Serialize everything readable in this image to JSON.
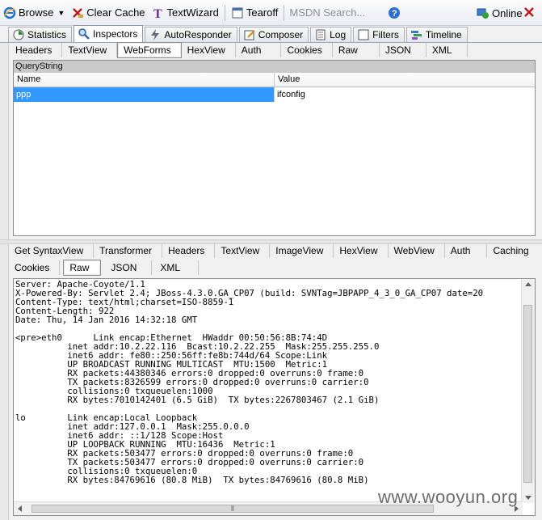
{
  "toolbar": {
    "browse": "Browse",
    "clear_cache": "Clear Cache",
    "textwizard": "TextWizard",
    "tearoff": "Tearoff",
    "search_placeholder": "MSDN Search...",
    "online": "Online"
  },
  "main_tabs": [
    "Statistics",
    "Inspectors",
    "AutoResponder",
    "Composer",
    "Log",
    "Filters",
    "Timeline"
  ],
  "request_tabs": [
    "Headers",
    "TextView",
    "WebForms",
    "HexView",
    "Auth",
    "Cookies",
    "Raw",
    "JSON",
    "XML"
  ],
  "querystring": {
    "title": "QueryString",
    "col_name": "Name",
    "col_value": "Value",
    "rows": [
      {
        "name": "ppp",
        "value": "ifconfig"
      }
    ]
  },
  "response_tabs_row1": [
    "Get SyntaxView",
    "Transformer",
    "Headers",
    "TextView",
    "ImageView",
    "HexView",
    "WebView",
    "Auth",
    "Caching"
  ],
  "response_tabs_row2": [
    "Cookies",
    "Raw",
    "JSON",
    "XML"
  ],
  "response_text": "Server: Apache-Coyote/1.1\nX-Powered-By: Servlet 2.4; JBoss-4.3.0.GA_CP07 (build: SVNTag=JBPAPP_4_3_0_GA_CP07 date=20\nContent-Type: text/html;charset=ISO-8859-1\nContent-Length: 922\nDate: Thu, 14 Jan 2016 14:32:18 GMT\n\n<pre>eth0      Link encap:Ethernet  HWaddr 00:50:56:8B:74:4D\n          inet addr:10.2.22.116  Bcast:10.2.22.255  Mask:255.255.255.0\n          inet6 addr: fe80::250:56ff:fe8b:744d/64 Scope:Link\n          UP BROADCAST RUNNING MULTICAST  MTU:1500  Metric:1\n          RX packets:44380346 errors:0 dropped:0 overruns:0 frame:0\n          TX packets:8326599 errors:0 dropped:0 overruns:0 carrier:0\n          collisions:0 txqueuelen:1000\n          RX bytes:7010142401 (6.5 GiB)  TX bytes:2267803467 (2.1 GiB)\n\nlo        Link encap:Local Loopback\n          inet addr:127.0.0.1  Mask:255.0.0.0\n          inet6 addr: ::1/128 Scope:Host\n          UP LOOPBACK RUNNING  MTU:16436  Metric:1\n          RX packets:503477 errors:0 dropped:0 overruns:0 frame:0\n          TX packets:503477 errors:0 dropped:0 overruns:0 carrier:0\n          collisions:0 txqueuelen:0\n          RX bytes:84769616 (80.8 MiB)  TX bytes:84769616 (80.8 MiB)",
  "watermark": "www.wooyun.org"
}
